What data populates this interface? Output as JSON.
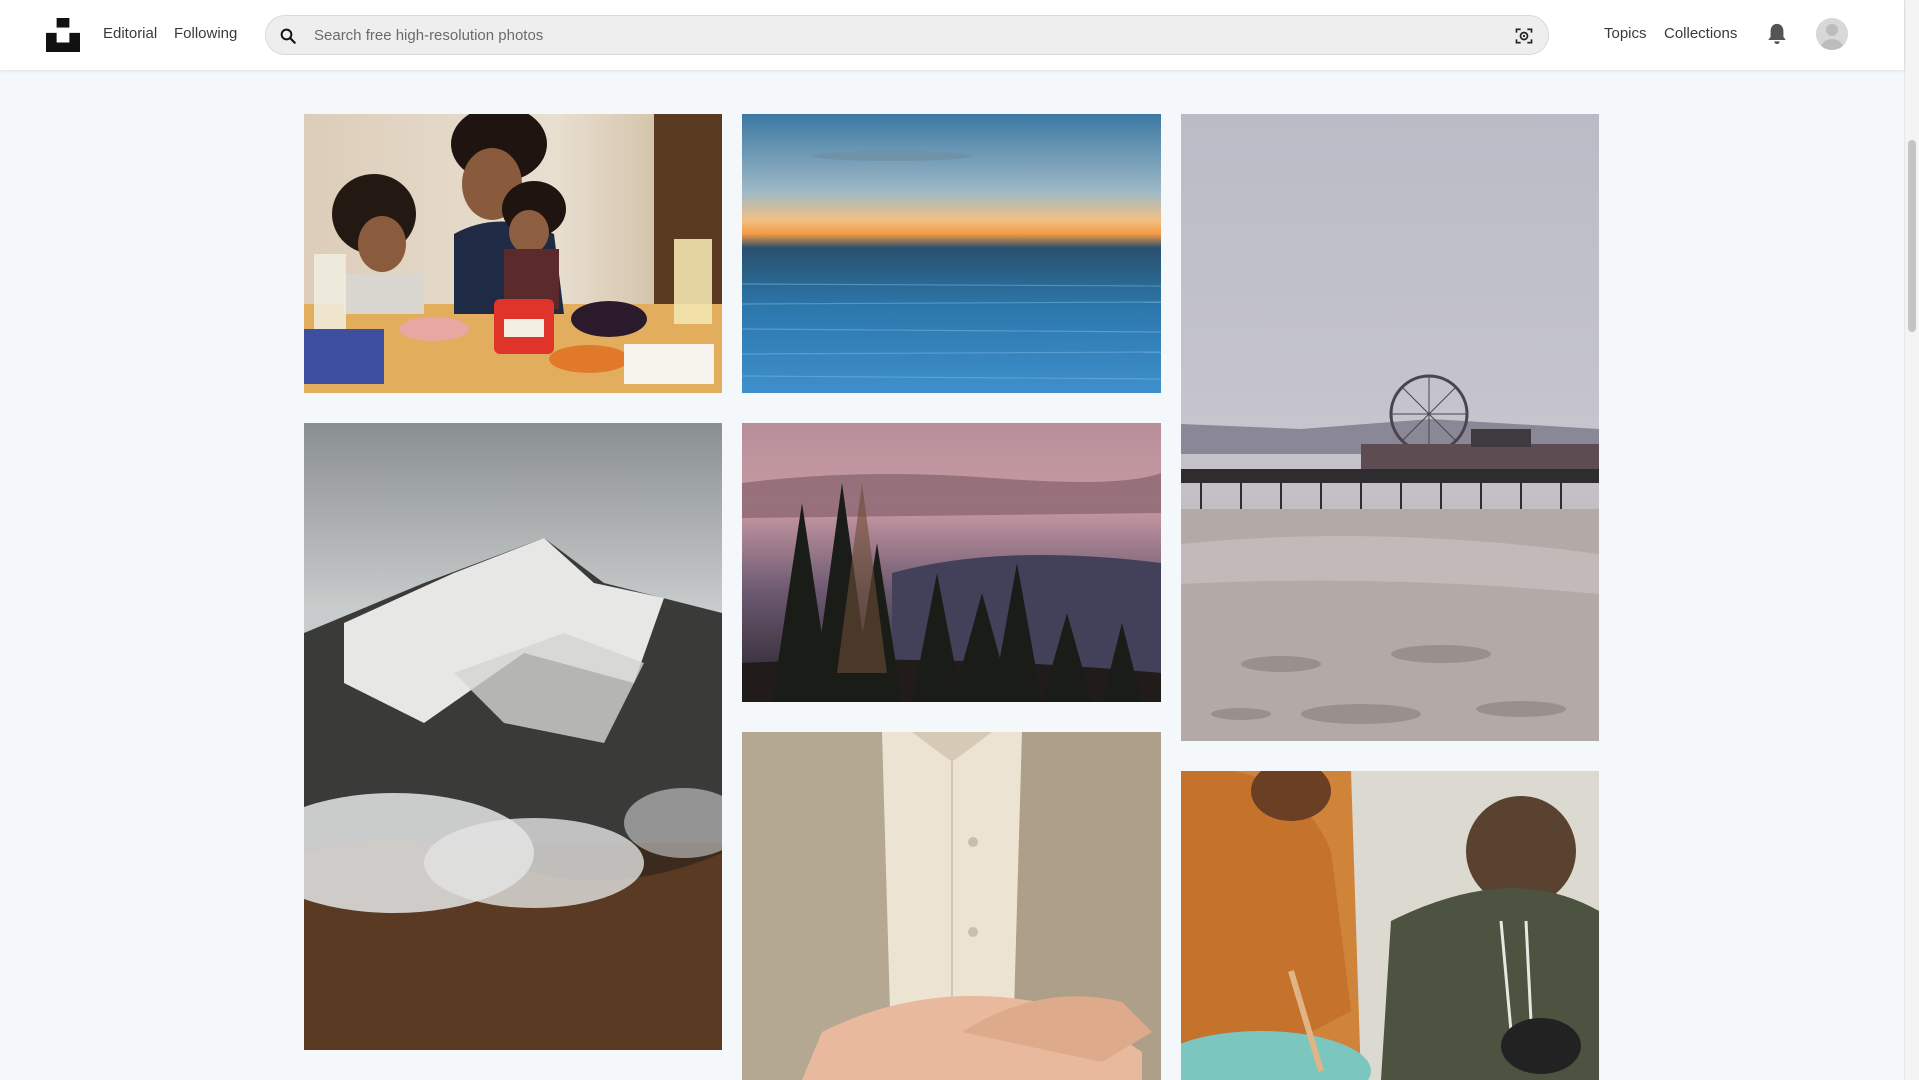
{
  "header": {
    "logo_icon": "unsplash-logo-icon",
    "nav": {
      "editorial": "Editorial",
      "following": "Following",
      "topics": "Topics",
      "collections": "Collections"
    },
    "search": {
      "placeholder": "Search free high-resolution photos",
      "value": "",
      "icon": "search-icon",
      "visual_search_icon": "visual-search-icon"
    },
    "notifications_icon": "bell-icon",
    "avatar_icon": "user-avatar-icon"
  },
  "colors": {
    "page_background": "#f5f8fb",
    "header_background": "#ffffff",
    "search_background": "#eeeeee"
  },
  "gallery": {
    "columns": [
      {
        "photos": [
          "family-meal-photo",
          "snowy-mountain-photo"
        ]
      },
      {
        "photos": [
          "ocean-sunset-photo",
          "forest-dusk-photo",
          "coat-shirt-photo"
        ]
      },
      {
        "photos": [
          "pier-ferris-wheel-photo",
          "people-cooking-photo"
        ]
      }
    ]
  }
}
